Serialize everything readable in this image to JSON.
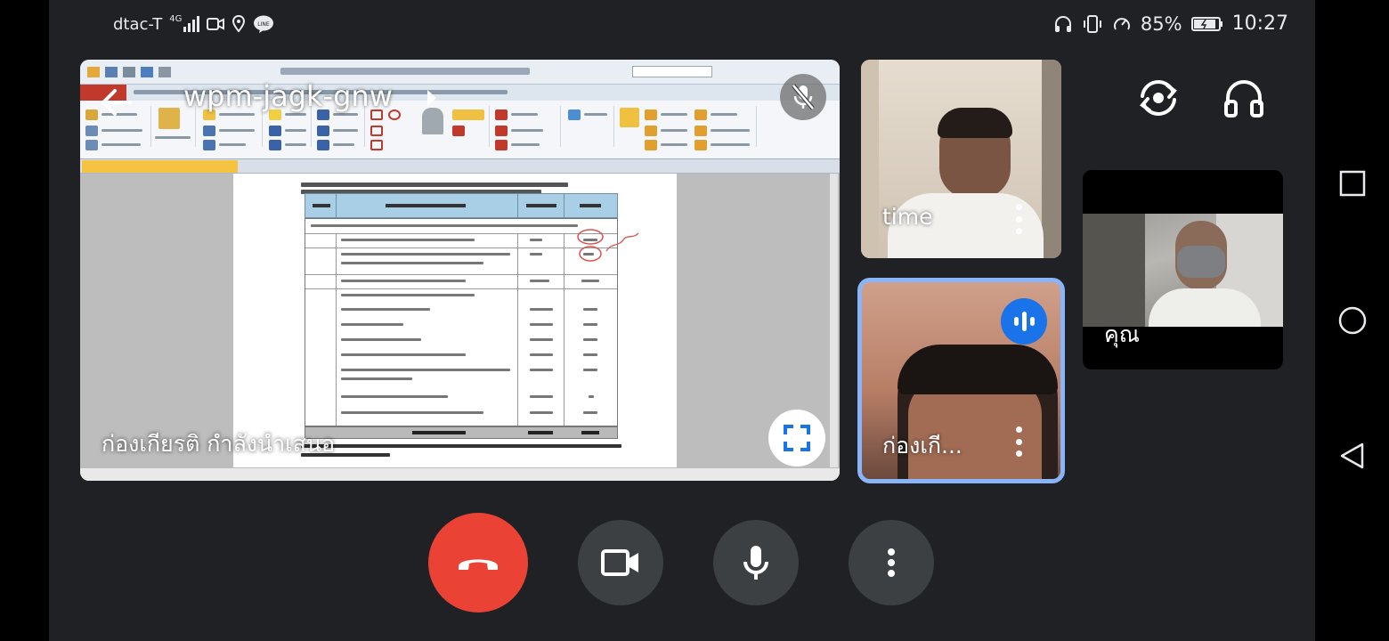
{
  "status_bar": {
    "carrier": "dtac-T",
    "network": "4G",
    "battery": "85%",
    "time": "10:27"
  },
  "presentation": {
    "meeting_code": "wpm-jagk-gnw",
    "caption": "ก่องเกียรติ กำลังนำเสนอ"
  },
  "participants": [
    {
      "name": "time"
    },
    {
      "name": "ก่องเกี..."
    },
    {
      "name": "คุณ"
    }
  ],
  "colors": {
    "end_call": "#ea4335",
    "speaking_badge": "#1a73e8",
    "active_border": "#8ab4f8",
    "control_bg": "#3c4043",
    "background": "#202124"
  },
  "icons": {
    "back": "arrow-left-icon",
    "mic_off": "mic-off-icon",
    "fullscreen": "fullscreen-icon",
    "switch_camera": "switch-camera-icon",
    "audio": "headphones-icon",
    "end_call": "phone-hangup-icon",
    "camera": "videocam-icon",
    "mic": "mic-icon",
    "more": "more-vert-icon"
  }
}
